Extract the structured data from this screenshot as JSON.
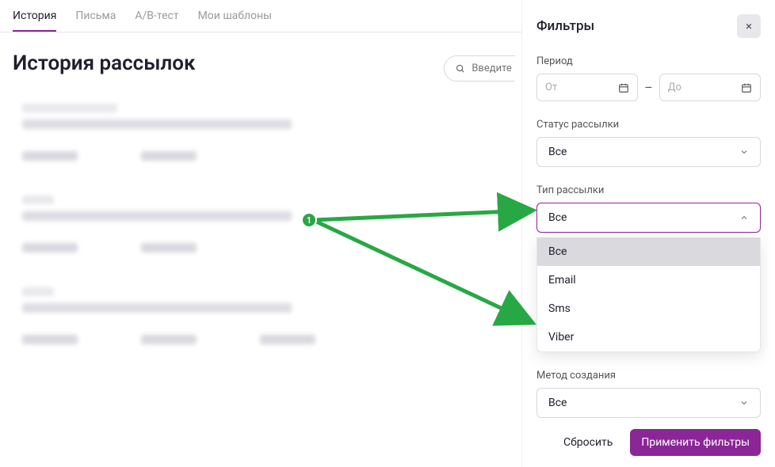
{
  "tabs": {
    "history": "История",
    "letters": "Письма",
    "abtest": "A/B-тест",
    "templates": "Мои шаблоны"
  },
  "page_title": "История рассылок",
  "search": {
    "placeholder": "Введите"
  },
  "filters": {
    "title": "Фильтры",
    "period": {
      "label": "Период",
      "from": "От",
      "to": "До"
    },
    "status": {
      "label": "Статус рассылки",
      "value": "Все"
    },
    "type": {
      "label": "Тип рассылки",
      "value": "Все",
      "options": {
        "all": "Все",
        "email": "Email",
        "sms": "Sms",
        "viber": "Viber"
      }
    },
    "method": {
      "label": "Метод создания",
      "value": "Все"
    },
    "reset": "Сбросить",
    "apply": "Применить фильтры"
  },
  "annotation": {
    "badge": "1"
  }
}
